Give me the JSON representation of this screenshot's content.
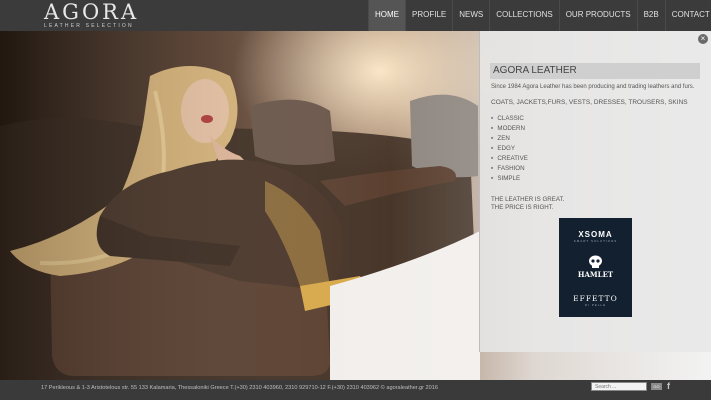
{
  "brand": {
    "name": "AGORA",
    "tagline": "LEATHER SELECTION"
  },
  "nav": {
    "items": [
      {
        "label": "HOME",
        "active": true
      },
      {
        "label": "PROFILE",
        "active": false
      },
      {
        "label": "NEWS",
        "active": false
      },
      {
        "label": "COLLECTIONS",
        "active": false
      },
      {
        "label": "OUR PRODUCTS",
        "active": false
      },
      {
        "label": "B2B",
        "active": false
      },
      {
        "label": "CONTACT US",
        "active": false
      }
    ]
  },
  "panel": {
    "title": "AGORA LEATHER",
    "intro": "Since 1984 Agora Leather has been producing and trading leathers and furs.",
    "categories": "COATS, JACKETS,FURS, VESTS, DRESSES, TROUSERS, SKINS",
    "styles": [
      "CLASSIC",
      "MODERN",
      "ZEN",
      "EDGY",
      "CREATIVE",
      "FASHION",
      "SIMPLE"
    ],
    "slogan_line1": "THE LEATHER IS GREAT.",
    "slogan_line2": "THE PRICE IS RIGHT.",
    "close_symbol": "×"
  },
  "brands_logo": {
    "xsoma": "XSOMA",
    "xsoma_sub": "SMART SOLUTIONS",
    "hamlet": "HAMLET",
    "effetto": "EFFETTO",
    "effetto_sub": "DI PELLE"
  },
  "footer": {
    "text": "17 Perikleous & 1-3 Aristotelous str. 55 133 Kalamaria, Thessaloniki Greece T.(+30) 2310 403960, 2310 929710-12 F.(+30) 2310 403962 © agoraleather.gr 2016",
    "search_placeholder": "Search ...",
    "go_label": "GO",
    "facebook": "f"
  },
  "colors": {
    "header": "#3b3b3b",
    "panel": "#e8e8e8",
    "brand_box": "#132030"
  }
}
